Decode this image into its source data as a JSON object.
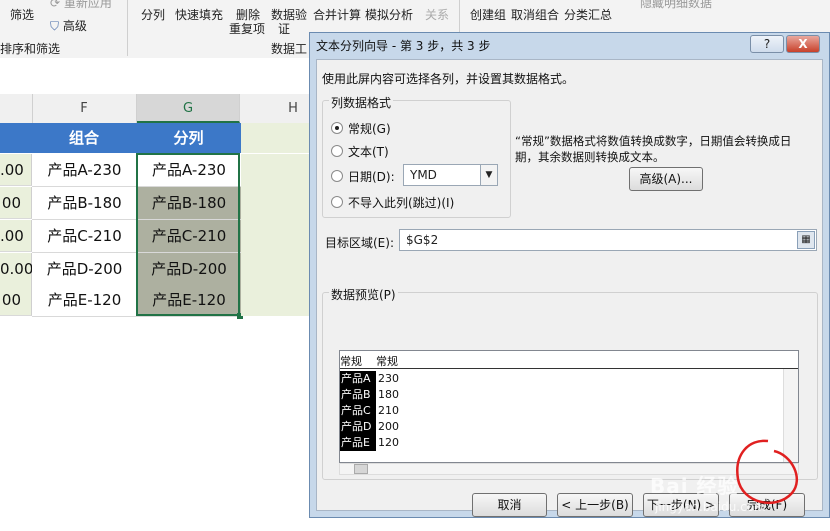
{
  "ribbon": {
    "filter": "筛选",
    "reapply": "重新应用",
    "advanced": "高级",
    "sort_filter_group": "排序和筛选",
    "text_to_columns": "分列",
    "flash_fill": "快速填充",
    "remove_dup_1": "删除",
    "remove_dup_2": "重复项",
    "data_valid_1": "数据验",
    "data_valid_2": "证",
    "consolidate": "合并计算",
    "what_if": "模拟分析",
    "relationships": "关系",
    "data_tools_group": "数据工",
    "group": "创建组",
    "ungroup": "取消组合",
    "subtotal": "分类汇总",
    "hide_detail": "隐藏明细数据"
  },
  "sheet": {
    "columns": [
      "F",
      "G",
      "H"
    ],
    "header": {
      "f": "组合",
      "g": "分列"
    },
    "col_a_values": [
      ".00",
      "00",
      ".00",
      "0.00",
      "00"
    ],
    "col_f_values": [
      "产品A-230",
      "产品B-180",
      "产品C-210",
      "产品D-200",
      "产品E-120"
    ],
    "col_g_values": [
      "产品A-230",
      "产品B-180",
      "产品C-210",
      "产品D-200",
      "产品E-120"
    ]
  },
  "dialog": {
    "title": "文本分列向导 - 第 3 步，共 3 步",
    "help_btn": "?",
    "close_btn": "X",
    "instruction": "使用此屏内容可选择各列，并设置其数据格式。",
    "group_title": "列数据格式",
    "options": [
      "常规(G)",
      "文本(T)",
      "日期(D):",
      "不导入此列(跳过)(I)"
    ],
    "selected_option": "常规(G)",
    "date_format": "YMD",
    "description_1": "“常规”数据格式将数值转换成数字，日期值会转换成日",
    "description_2": "期，其余数据则转换成文本。",
    "advanced_btn": "高级(A)...",
    "destination_label": "目标区域(E):",
    "destination_value": "$G$2",
    "preview_label": "数据预览(P)",
    "preview_headers": [
      "常规",
      "常规"
    ],
    "preview_rows": [
      [
        "产品A",
        "230"
      ],
      [
        "产品B",
        "180"
      ],
      [
        "产品C",
        "210"
      ],
      [
        "产品D",
        "200"
      ],
      [
        "产品E",
        "120"
      ]
    ],
    "cancel_btn": "取消",
    "back_btn": "< 上一步(B)",
    "next_btn": "下一步(N) >",
    "finish_btn": "完成(F)"
  },
  "watermark": {
    "brand": "Bai 经验",
    "url": "jingyan.baidu.com"
  },
  "colors": {
    "header_blue": "#3c78c8",
    "light_green": "#eaf0dc",
    "selection_gray": "#adb0a0",
    "dialog_frame": "#c7d8ea",
    "annotation_red": "#e02020"
  }
}
